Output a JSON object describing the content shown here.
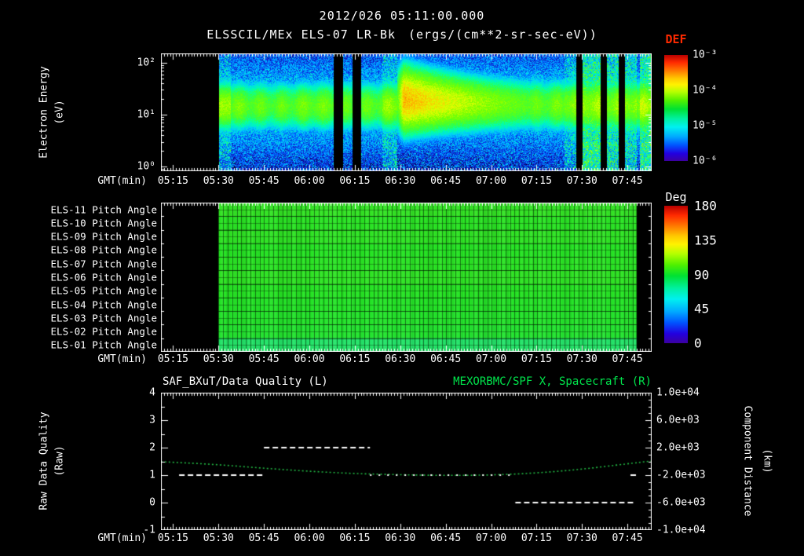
{
  "header": {
    "datetime": "2012/026 05:11:00.000",
    "subtitle": "ELSSCIL/MEx ELS-07 LR-Bk",
    "units": "(ergs/(cm**2-sr-sec-eV))"
  },
  "time_axis": {
    "label": "GMT(min)",
    "start": "05:11",
    "end": "07:53",
    "ticks": [
      "05:15",
      "05:30",
      "05:45",
      "06:00",
      "06:15",
      "06:30",
      "06:45",
      "07:00",
      "07:15",
      "07:30",
      "07:45"
    ]
  },
  "panels": {
    "spectrogram": {
      "ylabel": "Electron Energy",
      "ylabel_units": "(eV)",
      "yticks": [
        "10²",
        "10¹",
        "10⁰"
      ],
      "colorbar": {
        "title": "DEF",
        "title_color": "#ff2a00",
        "ticks": [
          "10⁻³",
          "10⁻⁴",
          "10⁻⁵",
          "10⁻⁶"
        ]
      }
    },
    "pitch": {
      "row_labels": [
        "ELS-11 Pitch Angle",
        "ELS-10 Pitch Angle",
        "ELS-09 Pitch Angle",
        "ELS-08 Pitch Angle",
        "ELS-07 Pitch Angle",
        "ELS-06 Pitch Angle",
        "ELS-05 Pitch Angle",
        "ELS-04 Pitch Angle",
        "ELS-03 Pitch Angle",
        "ELS-02 Pitch Angle",
        "ELS-01 Pitch Angle"
      ],
      "colorbar": {
        "title": "Deg",
        "ticks": [
          "180",
          "135",
          "90",
          "45",
          "0"
        ]
      }
    },
    "quality": {
      "title_left": "SAF_BXuT/Data Quality (L)",
      "title_right": "MEXORBMC/SPF X, Spacecraft (R)",
      "title_right_color": "#00e54c",
      "ylabel": "Raw Data Quality",
      "ylabel_units": "(Raw)",
      "yticks_left": [
        "4",
        "3",
        "2",
        "1",
        "0",
        "-1"
      ],
      "ylabel_right": "Component Distance",
      "ylabel_right_units": "(km)",
      "yticks_right": [
        "1.0e+04",
        "6.0e+03",
        "2.0e+03",
        "-2.0e+03",
        "-6.0e+03",
        "-1.0e+04"
      ]
    }
  },
  "chart_data": [
    {
      "type": "heatmap",
      "name": "electron_energy_spectrogram",
      "title": "ELSSCIL/MEx ELS-07 LR-Bk",
      "flux_units": "ergs/(cm**2-sr-sec-eV)",
      "xlabel": "GMT(min)",
      "x_range": [
        "05:11",
        "07:53"
      ],
      "x_ticks": [
        "05:15",
        "05:30",
        "05:45",
        "06:00",
        "06:15",
        "06:30",
        "06:45",
        "07:00",
        "07:15",
        "07:30",
        "07:45"
      ],
      "ylabel": "Electron Energy (eV)",
      "y_scale": "log",
      "y_range_eV": [
        1,
        150
      ],
      "colorbar": {
        "label": "DEF",
        "scale": "log",
        "range": [
          1e-06,
          0.001
        ],
        "ticks": [
          "10⁻³",
          "10⁻⁴",
          "10⁻⁵",
          "10⁻⁶"
        ]
      },
      "data_start": "05:30",
      "features": {
        "main_band_energy_eV": [
          8,
          30
        ],
        "typical_band_flux": 0.0001,
        "enhancement": {
          "time": "06:30",
          "peak_flux": 0.0005,
          "decays_until": "07:09"
        },
        "data_gaps": [
          "06:08-06:11",
          "06:14-06:17",
          "07:28-07:30",
          "07:36-07:38",
          "07:42-07:44"
        ],
        "bright_columns": [
          "05:30-05:34",
          "06:24-06:29",
          "07:24-07:28",
          "07:30-07:36",
          "07:38-07:42",
          "07:44-07:48",
          "07:49-07:53"
        ]
      }
    },
    {
      "type": "heatmap",
      "name": "pitch_angle_panel",
      "rows": [
        "ELS-11 Pitch Angle",
        "ELS-10 Pitch Angle",
        "ELS-09 Pitch Angle",
        "ELS-08 Pitch Angle",
        "ELS-07 Pitch Angle",
        "ELS-06 Pitch Angle",
        "ELS-05 Pitch Angle",
        "ELS-04 Pitch Angle",
        "ELS-03 Pitch Angle",
        "ELS-02 Pitch Angle",
        "ELS-01 Pitch Angle"
      ],
      "row_values_deg": [
        97,
        95,
        96,
        94,
        95,
        96,
        94,
        93,
        92,
        91,
        78
      ],
      "colorbar": {
        "label": "Deg",
        "range": [
          0,
          180
        ],
        "ticks": [
          180,
          135,
          90,
          45,
          0
        ]
      },
      "data_start": "05:30",
      "data_end": "07:48",
      "xlabel": "GMT(min)",
      "x_ticks": [
        "05:15",
        "05:30",
        "05:45",
        "06:00",
        "06:15",
        "06:30",
        "06:45",
        "07:00",
        "07:15",
        "07:30",
        "07:45"
      ]
    },
    {
      "type": "line",
      "name": "quality_and_spacecraft_distance",
      "xlabel": "GMT(min)",
      "x_ticks": [
        "05:15",
        "05:30",
        "05:45",
        "06:00",
        "06:15",
        "06:30",
        "06:45",
        "07:00",
        "07:15",
        "07:30",
        "07:45"
      ],
      "ylabel_left": "Raw Data Quality (Raw)",
      "ylim_left": [
        -1,
        4
      ],
      "ylabel_right": "Component Distance (km)",
      "ylim_right": [
        -10000,
        10000
      ],
      "series": [
        {
          "name": "SAF_BXuT/Data Quality (L)",
          "axis": "left",
          "color": "#ffffff",
          "style": "dashed",
          "segments": [
            {
              "value": 1,
              "start": "05:17",
              "end": "05:45"
            },
            {
              "value": 2,
              "start": "05:45",
              "end": "06:20"
            },
            {
              "value": 1,
              "start": "06:20",
              "end": "07:08",
              "style": "sparse-dots"
            },
            {
              "value": 0,
              "start": "07:08",
              "end": "07:47"
            },
            {
              "value": 1,
              "start": "07:46",
              "end": "07:48"
            }
          ]
        },
        {
          "name": "MEXORBMC/SPF X, Spacecraft (R)",
          "axis": "right",
          "color": "#22bb44",
          "style": "dotted",
          "points": {
            "t": [
              "05:11",
              "05:15",
              "05:30",
              "05:45",
              "06:00",
              "06:15",
              "06:30",
              "06:45",
              "07:00",
              "07:15",
              "07:30",
              "07:45",
              "07:53"
            ],
            "x_km": [
              -60,
              -120,
              -480,
              -1000,
              -1450,
              -1780,
              -1950,
              -2050,
              -2000,
              -1700,
              -1150,
              -350,
              60
            ]
          }
        }
      ]
    }
  ]
}
